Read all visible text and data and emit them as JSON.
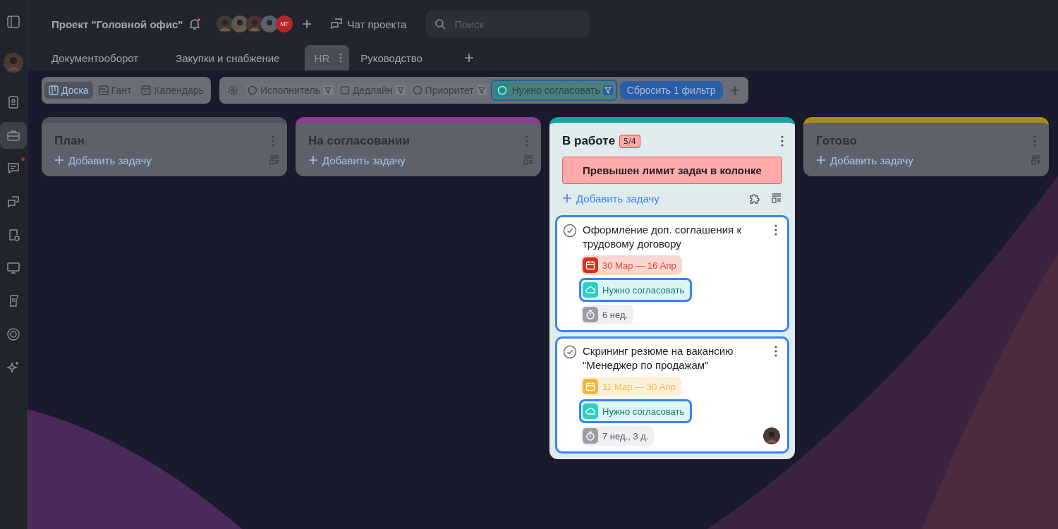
{
  "sidebar": {
    "items": [
      {
        "selected": false,
        "unread": false
      },
      {
        "selected": false,
        "unread": false
      },
      {
        "selected": false,
        "unread": false
      },
      {
        "selected": true,
        "unread": false
      },
      {
        "selected": false,
        "unread": true
      },
      {
        "selected": false,
        "unread": false
      },
      {
        "selected": false,
        "unread": false
      },
      {
        "selected": false,
        "unread": false
      },
      {
        "selected": false,
        "unread": false
      },
      {
        "selected": false,
        "unread": false
      },
      {
        "selected": false,
        "unread": false
      }
    ]
  },
  "header": {
    "project_title": "Проект \"Головной офис\"",
    "notifications_unread": true,
    "members": [
      {
        "kind": "photo"
      },
      {
        "kind": "photo"
      },
      {
        "kind": "photo"
      },
      {
        "kind": "photo"
      },
      {
        "kind": "initials",
        "initials": "МГ",
        "color": "#b3262b"
      }
    ],
    "chat_label": "Чат проекта",
    "search": {
      "placeholder": "Поиск"
    }
  },
  "tabs": [
    {
      "label": "Документооборот",
      "selected": false
    },
    {
      "label": "Закупки и снабжение",
      "selected": false
    },
    {
      "label": "HR",
      "selected": true
    },
    {
      "label": "Руководство",
      "selected": false
    }
  ],
  "views": [
    {
      "label": "Доска",
      "selected": true
    },
    {
      "label": "Гант",
      "selected": false
    },
    {
      "label": "Календарь",
      "selected": false
    }
  ],
  "filters": [
    {
      "label": "Исполнитель",
      "active": false
    },
    {
      "label": "Дедлайн",
      "active": false
    },
    {
      "label": "Приоритет",
      "active": false
    },
    {
      "label": "Нужно согласовать",
      "active": true
    }
  ],
  "reset_filters": "Сбросить 1 фильтр",
  "columns": [
    {
      "name": "План",
      "color": "#4e5560",
      "focused": false,
      "add_label": "Добавить задачу"
    },
    {
      "name": "На согласовании",
      "color": "#8a3b94",
      "focused": false,
      "add_label": "Добавить задачу"
    },
    {
      "name": "В работе",
      "color": "#12a5a1",
      "focused": true,
      "count": "5/4",
      "warning": "Превышен лимит задач в колонке",
      "add_label": "Добавить задачу",
      "tasks": [
        {
          "title": "Оформление доп. соглашения к трудовому договору",
          "dates": "30 Мар — 16 Апр",
          "color": "#d6301a",
          "tag": "Нужно согласовать",
          "duration": "6 нед.",
          "assigned": false
        },
        {
          "title": "Скрининг резюме на вакансию \"Менеджер по продажам\"",
          "dates": "11 Мар — 30 Апр",
          "color": "#f2b53a",
          "tag": "Нужно согласовать",
          "duration": "7 нед., 3 д.",
          "assigned": true
        }
      ]
    },
    {
      "name": "Готово",
      "color": "#a78f15",
      "focused": false,
      "add_label": "Добавить задачу"
    }
  ]
}
